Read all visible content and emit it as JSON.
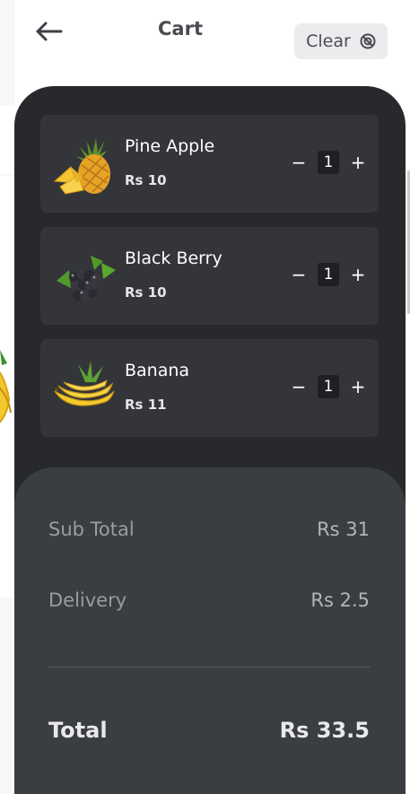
{
  "header": {
    "title": "Cart",
    "clear_label": "Clear"
  },
  "icons": {
    "back": "arrow-left-icon",
    "clear": "clear-circle-icon",
    "minus": "minus-icon",
    "plus": "plus-icon"
  },
  "items": [
    {
      "name": "Pine Apple",
      "price": "Rs 10",
      "qty": "1",
      "minus": "−",
      "plus": "+"
    },
    {
      "name": "Black Berry",
      "price": "Rs 10",
      "qty": "1",
      "minus": "−",
      "plus": "+"
    },
    {
      "name": "Banana",
      "price": "Rs 11",
      "qty": "1",
      "minus": "−",
      "plus": "+"
    }
  ],
  "summary": {
    "subtotal_label": "Sub Total",
    "subtotal_value": "Rs 31",
    "delivery_label": "Delivery",
    "delivery_value": "Rs 2.5",
    "total_label": "Total",
    "total_value": "Rs 33.5"
  },
  "colors": {
    "panel": "#28292c",
    "card": "#333539",
    "summary": "#3a3d41",
    "header_text": "#4b4b52"
  }
}
